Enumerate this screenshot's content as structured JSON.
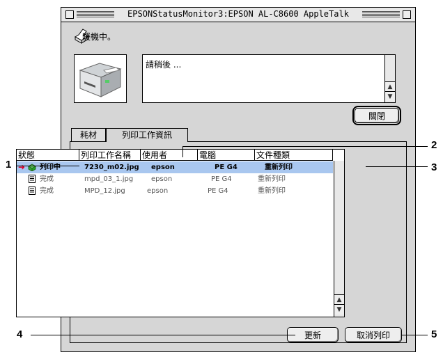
{
  "window": {
    "title": "EPSONStatusMonitor3:EPSON AL-C8600 AppleTalk"
  },
  "status": {
    "text": "暖機中。",
    "message": "請稍後 ..."
  },
  "buttons": {
    "close": "關閉",
    "refresh": "更新",
    "cancel_print": "取消列印"
  },
  "tabs": [
    {
      "label": "耗材"
    },
    {
      "label": "列印工作資訊"
    }
  ],
  "job_table": {
    "columns": [
      "狀態",
      "列印工作名稱",
      "使用者",
      "電腦",
      "文件種類"
    ],
    "rows": [
      {
        "status": "列印中",
        "job": "7230_m02.jpg",
        "user": "epson",
        "computer": "PE G4",
        "type": "重新列印"
      },
      {
        "status": "完成",
        "job": "mpd_03_1.jpg",
        "user": "epson",
        "computer": "PE G4",
        "type": "重新列印"
      },
      {
        "status": "完成",
        "job": "MPD_12.jpg",
        "user": "epson",
        "computer": "PE G4",
        "type": "重新列印"
      }
    ]
  },
  "callouts": [
    "1",
    "2",
    "3",
    "4",
    "5"
  ],
  "colors": {
    "selection": "#a9c7ef",
    "arrow": "#e0002a"
  },
  "icons": [
    "close-box-icon",
    "zoom-box-icon",
    "printer-icon",
    "printing-status-icon",
    "document-icon",
    "scroll-up-arrow-icon",
    "scroll-down-arrow-icon"
  ]
}
